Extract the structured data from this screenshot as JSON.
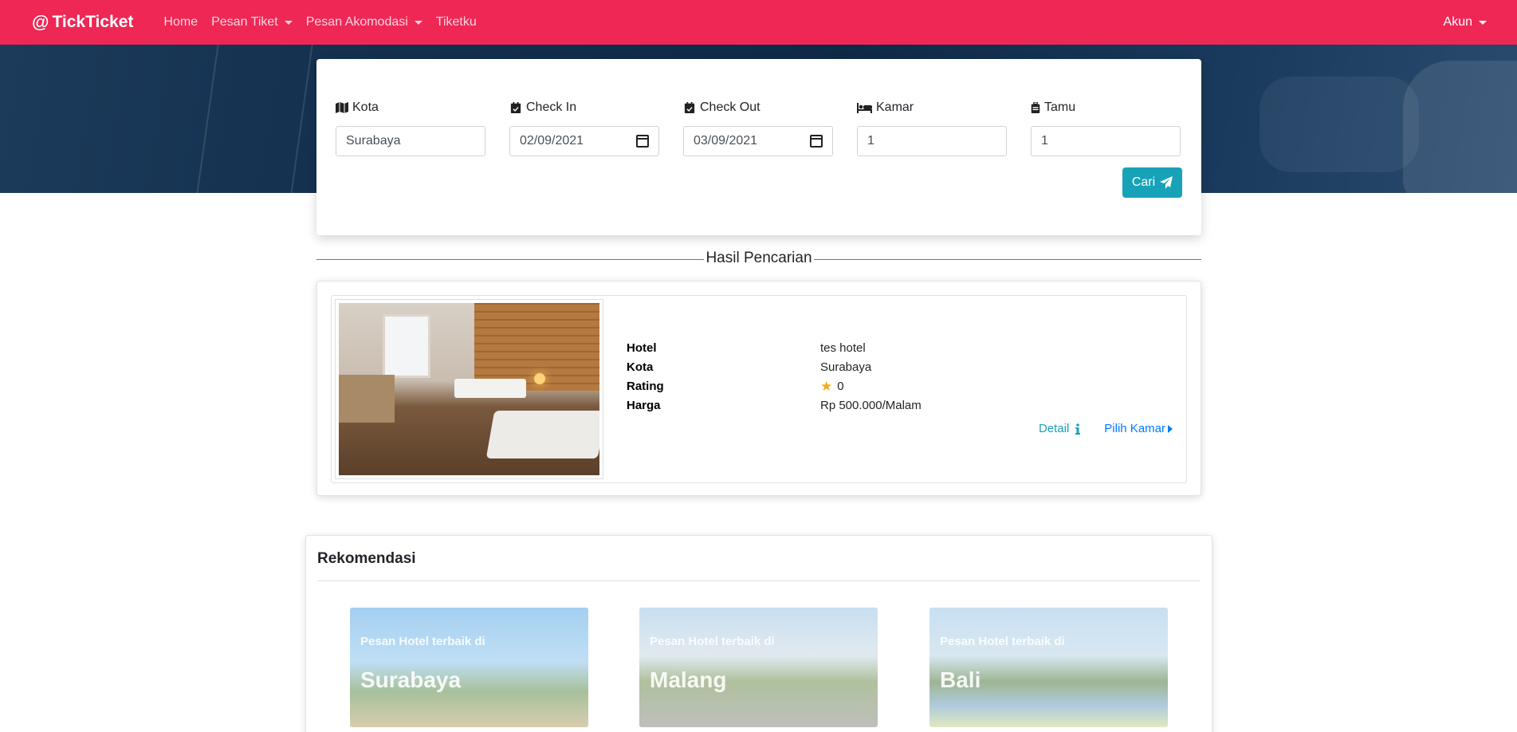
{
  "navbar": {
    "brand_symbol": "@",
    "brand": "TickTicket",
    "links": [
      "Home",
      "Pesan Tiket",
      "Pesan Akomodasi",
      "Tiketku"
    ],
    "account": "Akun",
    "color": "#ee2755"
  },
  "search": {
    "kota": {
      "label": "Kota",
      "value": "Surabaya",
      "icon": "map-icon"
    },
    "checkin": {
      "label": "Check In",
      "value": "02/09/2021",
      "icon": "calendar-check-icon"
    },
    "checkout": {
      "label": "Check Out",
      "value": "03/09/2021",
      "icon": "calendar-check-icon"
    },
    "kamar": {
      "label": "Kamar",
      "value": "1",
      "icon": "bed-icon"
    },
    "tamu": {
      "label": "Tamu",
      "value": "1",
      "icon": "suitcase-icon"
    },
    "button": "Cari",
    "button_color": "#17a2b8"
  },
  "results": {
    "title": "Hasil Pencarian",
    "items": [
      {
        "labels": {
          "hotel": "Hotel",
          "kota": "Kota",
          "rating": "Rating",
          "harga": "Harga"
        },
        "hotel": "tes hotel",
        "kota": "Surabaya",
        "rating": "0",
        "harga": "Rp 500.000/Malam",
        "detail": "Detail",
        "pilih": "Pilih Kamar"
      }
    ]
  },
  "rekomendasi": {
    "title": "Rekomendasi",
    "cities": [
      {
        "tagline": "Pesan Hotel terbaik di",
        "name": "Surabaya"
      },
      {
        "tagline": "Pesan Hotel terbaik di",
        "name": "Malang"
      },
      {
        "tagline": "Pesan Hotel terbaik di",
        "name": "Bali"
      }
    ]
  }
}
